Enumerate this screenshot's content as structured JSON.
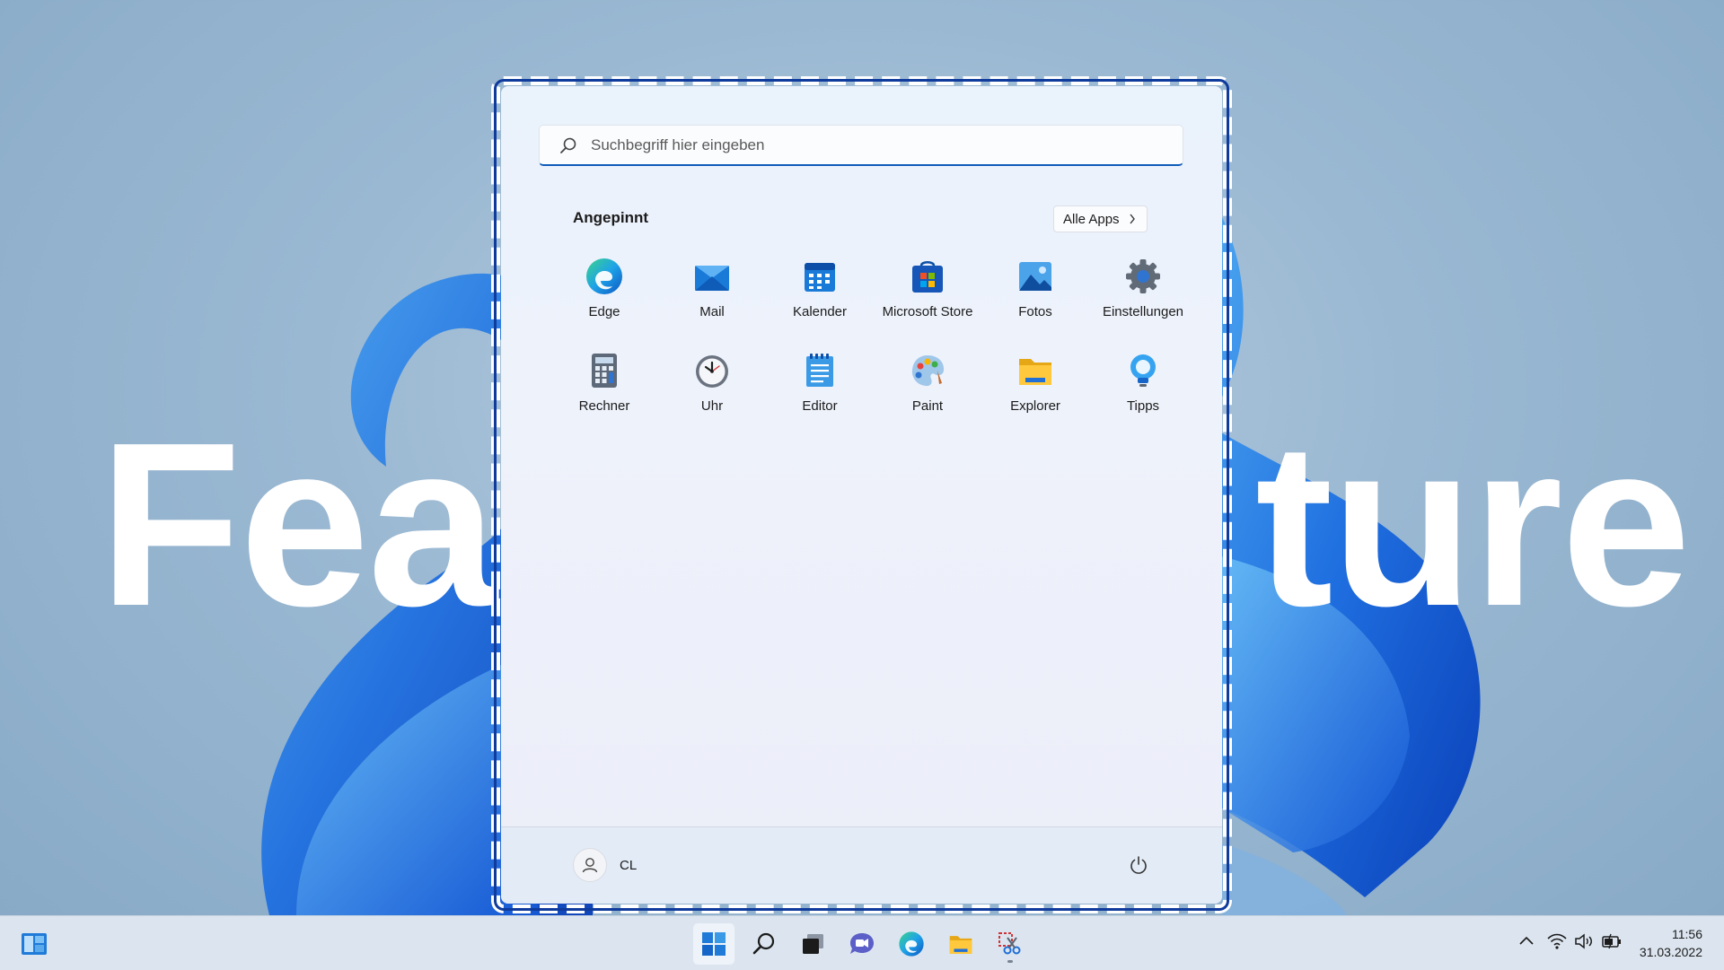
{
  "overlay_text": {
    "left": "Fea",
    "right": "ture"
  },
  "start_menu": {
    "search_placeholder": "Suchbegriff hier eingeben",
    "pinned_title": "Angepinnt",
    "all_apps_label": "Alle Apps",
    "apps": [
      {
        "label": "Edge",
        "icon": "edge-icon"
      },
      {
        "label": "Mail",
        "icon": "mail-icon"
      },
      {
        "label": "Kalender",
        "icon": "calendar-icon"
      },
      {
        "label": "Microsoft Store",
        "icon": "store-icon"
      },
      {
        "label": "Fotos",
        "icon": "photos-icon"
      },
      {
        "label": "Einstellungen",
        "icon": "settings-icon"
      },
      {
        "label": "Rechner",
        "icon": "calculator-icon"
      },
      {
        "label": "Uhr",
        "icon": "clock-icon"
      },
      {
        "label": "Editor",
        "icon": "notepad-icon"
      },
      {
        "label": "Paint",
        "icon": "paint-icon"
      },
      {
        "label": "Explorer",
        "icon": "folder-icon"
      },
      {
        "label": "Tipps",
        "icon": "tips-icon"
      }
    ],
    "user_name": "CL"
  },
  "taskbar": {
    "items": [
      "widgets-icon",
      "start-icon",
      "search-icon",
      "task-view-icon",
      "chat-icon",
      "edge-icon",
      "file-explorer-icon",
      "snipping-tool-icon"
    ],
    "time": "11:56",
    "date": "31.03.2022"
  },
  "colors": {
    "accent": "#0f5cb8",
    "wallpaper": "#9ab8d2",
    "taskbar": "#dce5ef"
  }
}
